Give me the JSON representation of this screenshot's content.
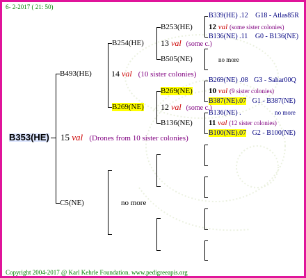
{
  "header": {
    "date": "6- 2-2017 ( 21: 50)"
  },
  "footer": {
    "copyright": "Copyright 2004-2017 @ Karl Kehrle Foundation.   www.pedigreeapis.org"
  },
  "colors": {
    "frame": "#e0149a",
    "highlight": "#ffff00",
    "root_bg": "#dde6ff",
    "green": "#008000",
    "navy": "#000080",
    "purple": "#800080",
    "red": "#cc0000"
  },
  "pedigree": {
    "root": {
      "id": "B353(HE)",
      "num": "15",
      "val": "val",
      "note": "(Drones from 10 sister colonies)"
    },
    "sire": {
      "id": "B493(HE)",
      "num": "14",
      "val": "val",
      "note": "(10 sister colonies)"
    },
    "dam": {
      "id": "C5(NE)",
      "note": "no more"
    },
    "sire_sire": {
      "id": "B254(HE)",
      "num": "13",
      "val": "val",
      "note": "(some c.)"
    },
    "sire_dam": {
      "id": "B269(NE)",
      "num": "12",
      "val": "val",
      "note": "(some c.)"
    },
    "ss_s": {
      "id": "B253(HE)",
      "num": "12",
      "val": "val",
      "note": "(some sister colonies)"
    },
    "ss_d": {
      "id": "B505(NE)",
      "note": "no more"
    },
    "sd_s": {
      "id": "B269(NE)",
      "num": "10",
      "val": "val",
      "note": "(9 sister colonies)"
    },
    "sd_d": {
      "id": "B136(NE)",
      "num": "11",
      "val": "val",
      "note": "(12 sister colonies)"
    },
    "gen4": [
      {
        "id": "B339(HE)",
        "cc": ".12",
        "ref": "G18 - Atlas85R"
      },
      {
        "id": "B136(NE)",
        "cc": ".11",
        "ref": "G0 - B136(NE)"
      },
      {
        "id": "B269(NE)",
        "cc": ".08",
        "ref": "G3 - Sahar00Q"
      },
      {
        "id": "B387(NE)",
        "cc": ".07",
        "ref": "G1 - B387(NE)"
      },
      {
        "id": "B136(NE)",
        "cc": ".",
        "ref": "no more"
      },
      {
        "id": "B100(NE)",
        "cc": ".07",
        "ref": "G2 - B100(NE)"
      }
    ]
  }
}
